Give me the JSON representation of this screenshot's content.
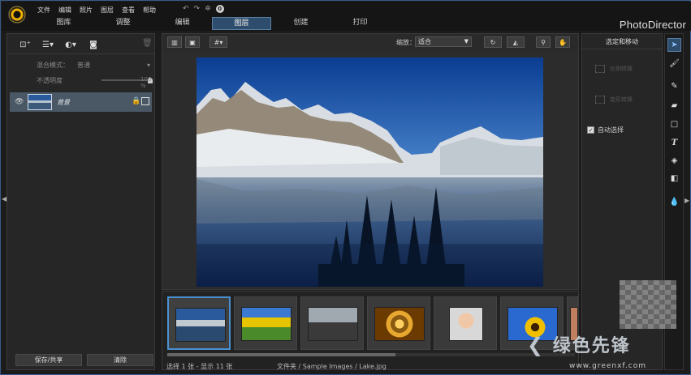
{
  "app": {
    "name": "PhotoDirector",
    "menu": [
      "文件",
      "编辑",
      "照片",
      "图层",
      "查看",
      "帮助"
    ],
    "modes": [
      "图库",
      "调整",
      "编辑",
      "图层",
      "创建",
      "打印"
    ],
    "active_mode": "图层"
  },
  "left_panel": {
    "blend_mode_label": "混合模式：",
    "blend_mode_value": "普通",
    "opacity_label": "不透明度",
    "opacity_value": "100 %",
    "opacity_fraction": 1.0,
    "layers": [
      {
        "name": "背景"
      }
    ],
    "buttons": {
      "save_share": "保存/共享",
      "clear": "清除"
    }
  },
  "center": {
    "zoom_label": "缩放：",
    "zoom_value": "适合"
  },
  "filmstrip": {
    "items": [
      "lake",
      "flowers",
      "city",
      "spiral",
      "woman",
      "sunflower",
      "partial"
    ],
    "selected_index": 0,
    "scroll_fraction": 0.56
  },
  "status": {
    "selection": "选择 1 张 - 显示 11 张",
    "path": "文件夹 / Sample Images / Lake.jpg"
  },
  "right_panel": {
    "title": "选定和移动",
    "option1": "比例转换",
    "option2": "变形转换",
    "auto_select_label": "自动选择",
    "auto_select_checked": true
  },
  "tools": [
    "select-arrow-icon",
    "paint-icon",
    "brush-icon",
    "eraser-icon",
    "rectangle-icon",
    "text-icon",
    "fill-icon",
    "gradient-icon",
    "drop-icon"
  ],
  "watermark": {
    "logo": "绿色先锋",
    "url": "www.greenxf.com"
  },
  "colors": {
    "accent": "#2e4c6c",
    "accent_border": "#5a7ea3",
    "selection_border": "#4a90d0"
  }
}
